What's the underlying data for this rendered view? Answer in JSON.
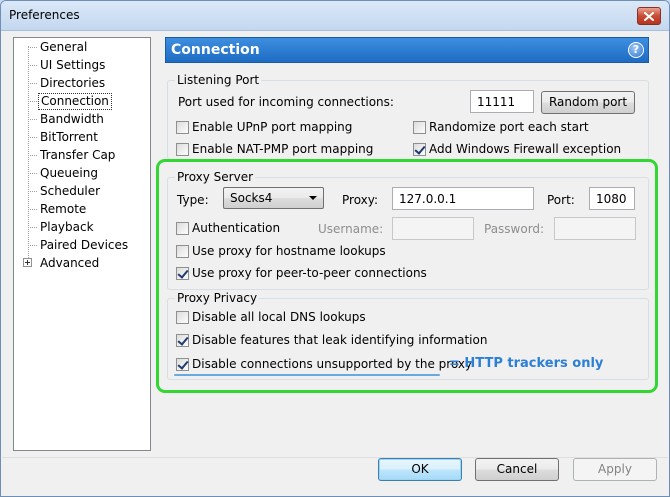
{
  "window": {
    "title": "Preferences"
  },
  "tree": {
    "items": [
      {
        "label": "General"
      },
      {
        "label": "UI Settings"
      },
      {
        "label": "Directories"
      },
      {
        "label": "Connection"
      },
      {
        "label": "Bandwidth"
      },
      {
        "label": "BitTorrent"
      },
      {
        "label": "Transfer Cap"
      },
      {
        "label": "Queueing"
      },
      {
        "label": "Scheduler"
      },
      {
        "label": "Remote"
      },
      {
        "label": "Playback"
      },
      {
        "label": "Paired Devices"
      },
      {
        "label": "Advanced"
      }
    ],
    "selected": "Connection"
  },
  "header": {
    "title": "Connection",
    "help": "?"
  },
  "listening_port": {
    "group_label": "Listening Port",
    "port_label": "Port used for incoming connections:",
    "port_value": "11111",
    "random_port_button": "Random port",
    "upnp": {
      "label": "Enable UPnP port mapping",
      "checked": false
    },
    "randomize": {
      "label": "Randomize port each start",
      "checked": false
    },
    "natpmp": {
      "label": "Enable NAT-PMP port mapping",
      "checked": false
    },
    "firewall": {
      "label": "Add Windows Firewall exception",
      "checked": true
    }
  },
  "proxy_server": {
    "group_label": "Proxy Server",
    "type_label": "Type:",
    "type_value": "Socks4",
    "proxy_label": "Proxy:",
    "proxy_value": "127.0.0.1",
    "port_label": "Port:",
    "port_value": "1080",
    "authentication": {
      "label": "Authentication",
      "checked": false
    },
    "username_label": "Username:",
    "password_label": "Password:",
    "hostname_lookups": {
      "label": "Use proxy for hostname lookups",
      "checked": false
    },
    "peer_connections": {
      "label": "Use proxy for peer-to-peer connections",
      "checked": true
    }
  },
  "proxy_privacy": {
    "group_label": "Proxy Privacy",
    "disable_dns": {
      "label": "Disable all local DNS lookups",
      "checked": false
    },
    "disable_leak": {
      "label": "Disable features that leak identifying information",
      "checked": true
    },
    "disable_unsupported": {
      "label": "Disable connections unsupported by the proxy",
      "checked": true
    }
  },
  "annotation": {
    "text": "= HTTP trackers only",
    "color": "#2b7fd4",
    "box_color": "#33d633"
  },
  "buttons": {
    "ok": "OK",
    "cancel": "Cancel",
    "apply": "Apply"
  }
}
